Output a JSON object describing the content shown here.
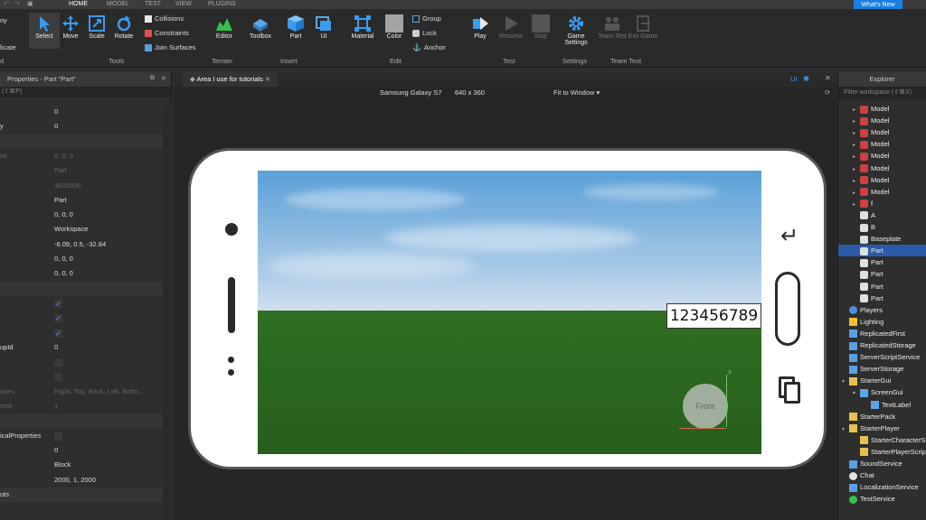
{
  "menu": {
    "tabs": [
      "HOME",
      "MODEL",
      "TEST",
      "VIEW",
      "PLUGINS"
    ],
    "whats_new": "What's New"
  },
  "ribbon": {
    "left_partial": [
      "oy",
      "licate",
      "d"
    ],
    "tools": [
      "Select",
      "Move",
      "Scale",
      "Rotate"
    ],
    "tools_small": [
      "Collisions",
      "Constraints",
      "Join Surfaces"
    ],
    "terrain": [
      "Editor"
    ],
    "insert": [
      "Toolbox",
      "Part",
      "UI"
    ],
    "edit": [
      "Material",
      "Color"
    ],
    "edit_small": [
      "Group",
      "Lock",
      "Anchor"
    ],
    "test": [
      "Play",
      "Resume",
      "Stop"
    ],
    "settings": [
      "Game Settings"
    ],
    "team_test": [
      "Team Test",
      "Exit Game"
    ],
    "groups": [
      "Tools",
      "Terrain",
      "Insert",
      "Edit",
      "Test",
      "Settings",
      "Team Test"
    ]
  },
  "properties": {
    "title": "Properties - Part \"Part\"",
    "filter": "(⇧⌘P)",
    "rows": [
      {
        "n": "",
        "v": "0",
        "t": "val"
      },
      {
        "n": "y",
        "v": "0",
        "t": "val"
      },
      {
        "n": "",
        "v": "",
        "t": "cat"
      },
      {
        "n": "ss",
        "v": "0, 0, 0",
        "t": "dim"
      },
      {
        "n": "",
        "v": "Part",
        "t": "dim"
      },
      {
        "n": "",
        "v": "3600000",
        "t": "dim"
      },
      {
        "n": "",
        "v": "Part",
        "t": "val"
      },
      {
        "n": "",
        "v": "0, 0, 0",
        "t": "val"
      },
      {
        "n": "",
        "v": "Workspace",
        "t": "val"
      },
      {
        "n": "",
        "v": "-6.09, 0.5, -32.84",
        "t": "val"
      },
      {
        "n": "",
        "v": "0, 0, 0",
        "t": "val"
      },
      {
        "n": "",
        "v": "0, 0, 0",
        "t": "val"
      },
      {
        "n": "",
        "v": "",
        "t": "cat"
      },
      {
        "n": "",
        "v": "✓",
        "t": "chk"
      },
      {
        "n": "",
        "v": "✓",
        "t": "chk"
      },
      {
        "n": "",
        "v": "✓",
        "t": "chk"
      },
      {
        "n": "upId",
        "v": "0",
        "t": "val"
      },
      {
        "n": "",
        "v": "",
        "t": "chk"
      },
      {
        "n": "",
        "v": "",
        "t": "chk"
      },
      {
        "n": "aces",
        "v": "Right, Top, Back, Left, Botto...",
        "t": "dim"
      },
      {
        "n": "rent",
        "v": "1",
        "t": "dim"
      },
      {
        "n": "",
        "v": "",
        "t": "cat"
      },
      {
        "n": "icalProperties",
        "v": "",
        "t": "chk"
      },
      {
        "n": "",
        "v": "0",
        "t": "val"
      },
      {
        "n": "",
        "v": "Block",
        "t": "val"
      },
      {
        "n": "",
        "v": "2000, 1, 2000",
        "t": "val"
      },
      {
        "n": "uts",
        "v": "",
        "t": "cat"
      }
    ]
  },
  "viewport": {
    "tab": "Area I use for tutorials",
    "device": "Samsung Galaxy S7",
    "resolution": "640 x 360",
    "fit": "Fit to Window",
    "ui_toggle": "UI",
    "text_label": "123456789",
    "front": "Front",
    "axis_y": "Y"
  },
  "explorer": {
    "title": "Explorer",
    "filter": "Filter workspace (⇧⌘X)",
    "items": [
      {
        "label": "Model",
        "indent": 2,
        "icon": "model",
        "arrow": "▸"
      },
      {
        "label": "Model",
        "indent": 2,
        "icon": "model",
        "arrow": "▸"
      },
      {
        "label": "Model",
        "indent": 2,
        "icon": "model",
        "arrow": "▸"
      },
      {
        "label": "Model",
        "indent": 2,
        "icon": "model",
        "arrow": "▸"
      },
      {
        "label": "Model",
        "indent": 2,
        "icon": "model",
        "arrow": "▸"
      },
      {
        "label": "Model",
        "indent": 2,
        "icon": "model",
        "arrow": "▸"
      },
      {
        "label": "Model",
        "indent": 2,
        "icon": "model",
        "arrow": "▸"
      },
      {
        "label": "Model",
        "indent": 2,
        "icon": "model",
        "arrow": "▸"
      },
      {
        "label": "f",
        "indent": 2,
        "icon": "model",
        "arrow": "▸"
      },
      {
        "label": "A",
        "indent": 2,
        "icon": "part",
        "arrow": ""
      },
      {
        "label": "B",
        "indent": 2,
        "icon": "part",
        "arrow": ""
      },
      {
        "label": "Baseplate",
        "indent": 2,
        "icon": "part",
        "arrow": ""
      },
      {
        "label": "Part",
        "indent": 2,
        "icon": "part",
        "arrow": "",
        "selected": true
      },
      {
        "label": "Part",
        "indent": 2,
        "icon": "part",
        "arrow": ""
      },
      {
        "label": "Part",
        "indent": 2,
        "icon": "part",
        "arrow": ""
      },
      {
        "label": "Part",
        "indent": 2,
        "icon": "part",
        "arrow": ""
      },
      {
        "label": "Part",
        "indent": 2,
        "icon": "part",
        "arrow": ""
      },
      {
        "label": "Players",
        "indent": 1,
        "icon": "players",
        "arrow": ""
      },
      {
        "label": "Lighting",
        "indent": 1,
        "icon": "lighting",
        "arrow": ""
      },
      {
        "label": "ReplicatedFirst",
        "indent": 1,
        "icon": "service",
        "arrow": ""
      },
      {
        "label": "ReplicatedStorage",
        "indent": 1,
        "icon": "service",
        "arrow": ""
      },
      {
        "label": "ServerScriptService",
        "indent": 1,
        "icon": "service",
        "arrow": ""
      },
      {
        "label": "ServerStorage",
        "indent": 1,
        "icon": "service",
        "arrow": ""
      },
      {
        "label": "StarterGui",
        "indent": 1,
        "icon": "folder",
        "arrow": "▾"
      },
      {
        "label": "ScreenGui",
        "indent": 2,
        "icon": "screengui",
        "arrow": "▾"
      },
      {
        "label": "TextLabel",
        "indent": 3,
        "icon": "textlabel",
        "arrow": ""
      },
      {
        "label": "StarterPack",
        "indent": 1,
        "icon": "folder",
        "arrow": ""
      },
      {
        "label": "StarterPlayer",
        "indent": 1,
        "icon": "folder",
        "arrow": "▾"
      },
      {
        "label": "StarterCharacterScripts",
        "indent": 2,
        "icon": "folder",
        "arrow": ""
      },
      {
        "label": "StarterPlayerScripts",
        "indent": 2,
        "icon": "folder",
        "arrow": ""
      },
      {
        "label": "SoundService",
        "indent": 1,
        "icon": "service",
        "arrow": ""
      },
      {
        "label": "Chat",
        "indent": 1,
        "icon": "chat",
        "arrow": ""
      },
      {
        "label": "LocalizationService",
        "indent": 1,
        "icon": "service",
        "arrow": ""
      },
      {
        "label": "TestService",
        "indent": 1,
        "icon": "check",
        "arrow": ""
      }
    ]
  },
  "colors": {
    "accent": "#1a7fe0",
    "selection": "#2b5aa8",
    "ground": "#2f6e22",
    "sky": "#7fb3e0"
  }
}
